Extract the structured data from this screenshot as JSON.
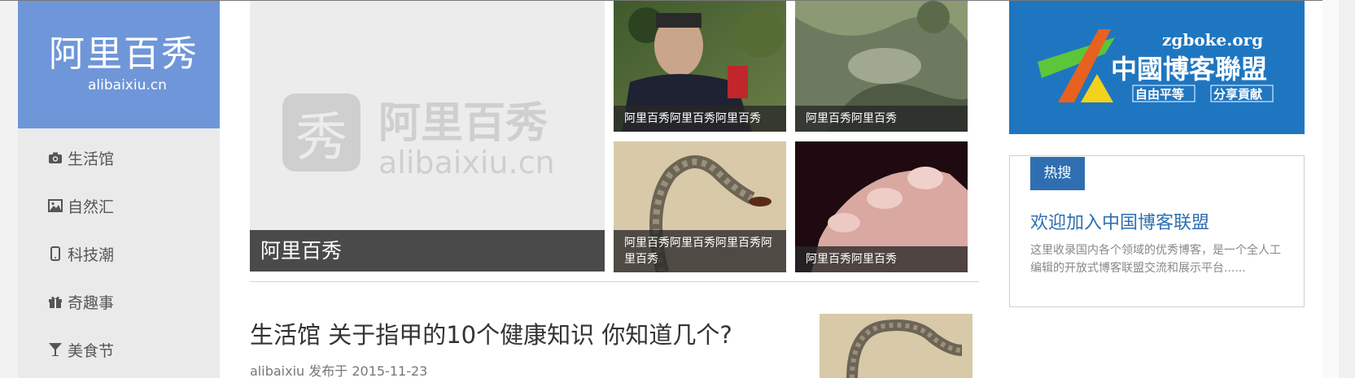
{
  "logo": {
    "cn": "阿里百秀",
    "en": "alibaixiu.cn"
  },
  "nav": [
    {
      "label": "生活馆",
      "icon": "camera-icon"
    },
    {
      "label": "自然汇",
      "icon": "image-icon"
    },
    {
      "label": "科技潮",
      "icon": "phone-icon"
    },
    {
      "label": "奇趣事",
      "icon": "gift-icon"
    },
    {
      "label": "美食节",
      "icon": "glass-icon"
    }
  ],
  "feature": {
    "caption": "阿里百秀",
    "watermark_cn": "阿里百秀",
    "watermark_en": "alibaixiu.cn",
    "watermark_glyph": "秀"
  },
  "thumbs": [
    {
      "caption": "阿里百秀阿里百秀阿里百秀"
    },
    {
      "caption": "阿里百秀阿里百秀"
    },
    {
      "caption": "阿里百秀阿里百秀阿里百秀阿里百秀"
    },
    {
      "caption": "阿里百秀阿里百秀"
    }
  ],
  "post": {
    "title": "生活馆 关于指甲的10个健康知识 你知道几个?",
    "author": "alibaixiu",
    "meta_suffix": "发布于 2015-11-23"
  },
  "banner": {
    "domain": "zgboke.org",
    "title": "中國博客聯盟",
    "slogan_left": "自由平等",
    "slogan_right": "分享貢献"
  },
  "hot": {
    "tag": "热搜",
    "title": "欢迎加入中国博客联盟",
    "desc": "这里收录国内各个领域的优秀博客，是一个全人工编辑的开放式博客联盟交流和展示平台......"
  },
  "colors": {
    "logo_bg": "#6f96d8",
    "accent": "#2f6fb1",
    "banner_bg": "#1f76c0"
  }
}
